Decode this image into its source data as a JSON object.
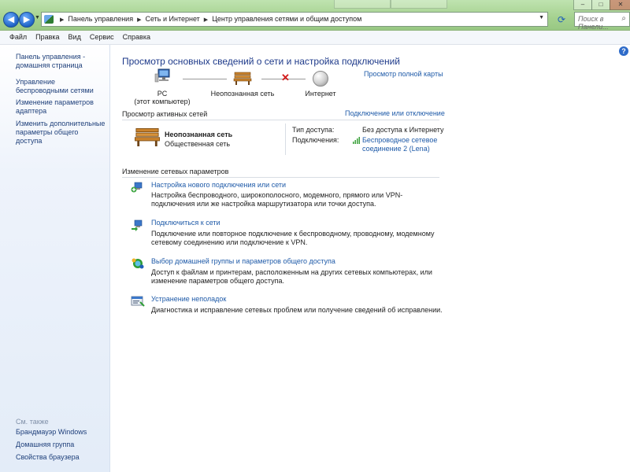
{
  "breadcrumb": {
    "items": [
      "Панель управления",
      "Сеть и Интернет",
      "Центр управления сетями и общим доступом"
    ]
  },
  "search": {
    "placeholder": "Поиск в Панели..."
  },
  "menu": {
    "items": [
      "Файл",
      "Правка",
      "Вид",
      "Сервис",
      "Справка"
    ]
  },
  "sidebar": {
    "links": [
      "Панель управления - домашняя страница",
      "Управление беспроводными сетями",
      "Изменение параметров адаптера",
      "Изменить дополнительные параметры общего доступа"
    ],
    "see_also_label": "См. также",
    "see_also": [
      "Брандмауэр Windows",
      "Домашняя группа",
      "Свойства браузера"
    ]
  },
  "main": {
    "title": "Просмотр основных сведений о сети и настройка подключений",
    "full_map_link": "Просмотр полной карты",
    "map": {
      "pc_name": "PC",
      "pc_sub": "(этот компьютер)",
      "network": "Неопознанная сеть",
      "internet": "Интернет"
    },
    "active_networks": {
      "header": "Просмотр активных сетей",
      "connect_link": "Подключение или отключение",
      "network_name": "Неопознанная сеть",
      "network_type": "Общественная сеть",
      "access_label": "Тип доступа:",
      "access_value": "Без доступа к Интернету",
      "connections_label": "Подключения:",
      "connection_line1": "Беспроводное сетевое",
      "connection_line2": "соединение 2 (Lena)"
    },
    "change_settings": {
      "header": "Изменение сетевых параметров",
      "tasks": [
        {
          "title": "Настройка нового подключения или сети",
          "desc": "Настройка беспроводного, широкополосного, модемного, прямого или VPN-подключения или же настройка маршрутизатора или точки доступа."
        },
        {
          "title": "Подключиться к сети",
          "desc": "Подключение или повторное подключение к беспроводному, проводному, модемному сетевому соединению или подключение к VPN."
        },
        {
          "title": "Выбор домашней группы и параметров общего доступа",
          "desc": "Доступ к файлам и принтерам, расположенным на других сетевых компьютерах, или изменение параметров общего доступа."
        },
        {
          "title": "Устранение неполадок",
          "desc": "Диагностика и исправление сетевых проблем или получение сведений об исправлении."
        }
      ]
    }
  }
}
